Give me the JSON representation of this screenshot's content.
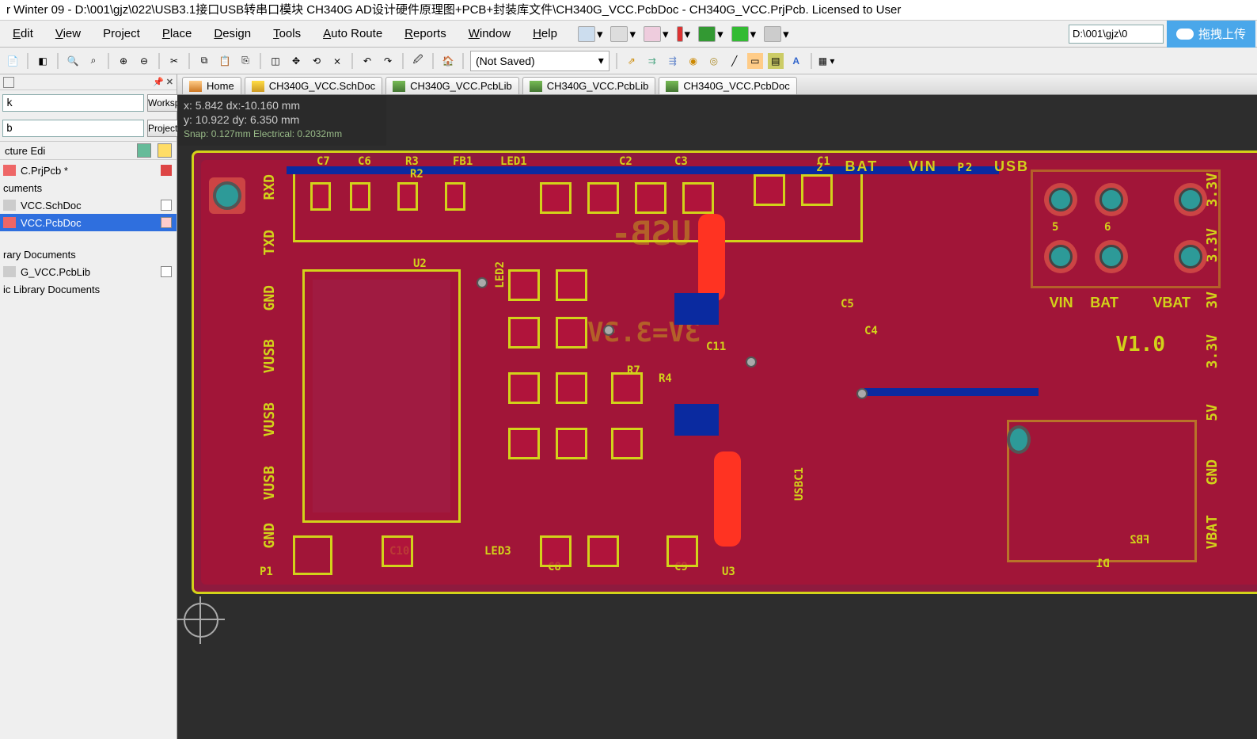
{
  "title": "r Winter 09 - D:\\001\\gjz\\022\\USB3.1接口USB转串口模块 CH340G AD设计硬件原理图+PCB+封装库文件\\CH340G_VCC.PcbDoc - CH340G_VCC.PrjPcb. Licensed to User",
  "menus": [
    "Edit",
    "View",
    "Project",
    "Place",
    "Design",
    "Tools",
    "Auto Route",
    "Reports",
    "Window",
    "Help"
  ],
  "right_path_value": "D:\\001\\gjz\\0",
  "upload_label": "拖拽上传",
  "save_state": "(Not Saved)",
  "left": {
    "ws_btn": "Workspace",
    "proj_btn": "Project",
    "field1": "k",
    "field2": "b",
    "section_label": "cture Edi",
    "tree": {
      "proj": "C.PrjPcb  *",
      "docs_header": "cuments",
      "sch": "VCC.SchDoc",
      "pcb": "VCC.PcbDoc",
      "lib_header": "rary Documents",
      "pcblib": "G_VCC.PcbLib",
      "iclib": "ic Library Documents"
    }
  },
  "tabs": [
    {
      "label": "Home",
      "type": "home"
    },
    {
      "label": "CH340G_VCC.SchDoc",
      "type": "sch"
    },
    {
      "label": "CH340G_VCC.PcbLib",
      "type": "pcb"
    },
    {
      "label": "CH340G_VCC.PcbLib",
      "type": "pcb"
    },
    {
      "label": "CH340G_VCC.PcbDoc",
      "type": "pcb",
      "active": true
    }
  ],
  "coord": {
    "line1": "x: 5.842    dx:-10.160 mm",
    "line2": "y: 10.922   dy:  6.350  mm",
    "line3": "Snap: 0.127mm Electrical: 0.2032mm"
  },
  "silk": {
    "left_col": [
      "RXD",
      "TXD",
      "GND",
      "VUSB",
      "VUSB",
      "VUSB",
      "GND"
    ],
    "right_col": [
      "3.3V",
      "3.3V",
      "3V",
      "3.3V",
      "5V",
      "GND",
      "VBAT"
    ],
    "p1": "P1",
    "p2": "P2",
    "p2_top": [
      "2",
      "BAT",
      "VIN",
      "USB"
    ],
    "p2_bot": [
      "VIN",
      "BAT",
      "VBAT"
    ],
    "p2_nums": [
      "5",
      "6"
    ],
    "version": "V1.0",
    "refs_top": [
      "C7",
      "C6",
      "R3",
      "FB1",
      "LED1",
      "C2",
      "C3",
      "C1"
    ],
    "u2": "U2",
    "u3": "U3",
    "led2": "LED2",
    "led3": "LED3",
    "c8": "C8",
    "c9": "C9",
    "c10": "C10",
    "c11": "C11",
    "c4": "C4",
    "c5": "C5",
    "r4": "R4",
    "r7": "R7",
    "r2": "R2",
    "usbc1": "USBC1",
    "fb2": "FB2",
    "d1": "D1",
    "mirror_usb": "USB-",
    "mirror_3v": "3V=3.3V"
  }
}
